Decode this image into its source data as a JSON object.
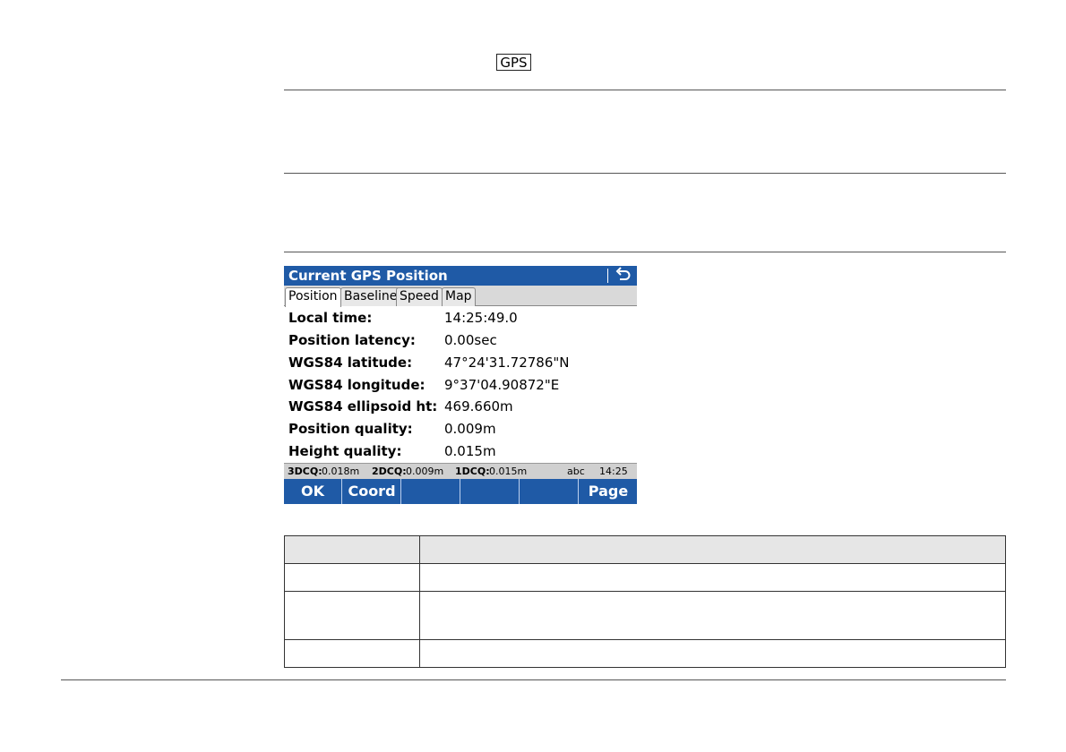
{
  "key_label": "GPS",
  "screen": {
    "title": "Current GPS Position",
    "back_icon": "back-arrow-icon",
    "tabs": [
      {
        "label": "Position",
        "active": true
      },
      {
        "label": "Baseline",
        "active": false
      },
      {
        "label": "Speed",
        "active": false
      },
      {
        "label": "Map",
        "active": false
      }
    ],
    "fields": [
      {
        "label": "Local time:",
        "value": "14:25:49.0"
      },
      {
        "label": "Position latency:",
        "value": "0.00sec"
      },
      {
        "label": "WGS84 latitude:",
        "value": "47°24'31.72786\"N"
      },
      {
        "label": "WGS84 longitude:",
        "value": "9°37'04.90872\"E"
      },
      {
        "label": "WGS84 ellipsoid ht:",
        "value": "469.660m"
      },
      {
        "label": "Position quality:",
        "value": "0.009m"
      },
      {
        "label": "Height quality:",
        "value": "0.015m"
      }
    ],
    "status": {
      "dcq3_label": "3DCQ:",
      "dcq3_value": "0.018m",
      "dcq2_label": "2DCQ:",
      "dcq2_value": "0.009m",
      "dcq1_label": "1DCQ:",
      "dcq1_value": "0.015m",
      "input_mode": "abc",
      "clock": "14:25"
    },
    "softkeys": [
      "OK",
      "Coord",
      "",
      "",
      "",
      "Page"
    ]
  },
  "colors": {
    "title_bar": "#1f5aa6",
    "softkey_bar": "#1f5aa6"
  }
}
